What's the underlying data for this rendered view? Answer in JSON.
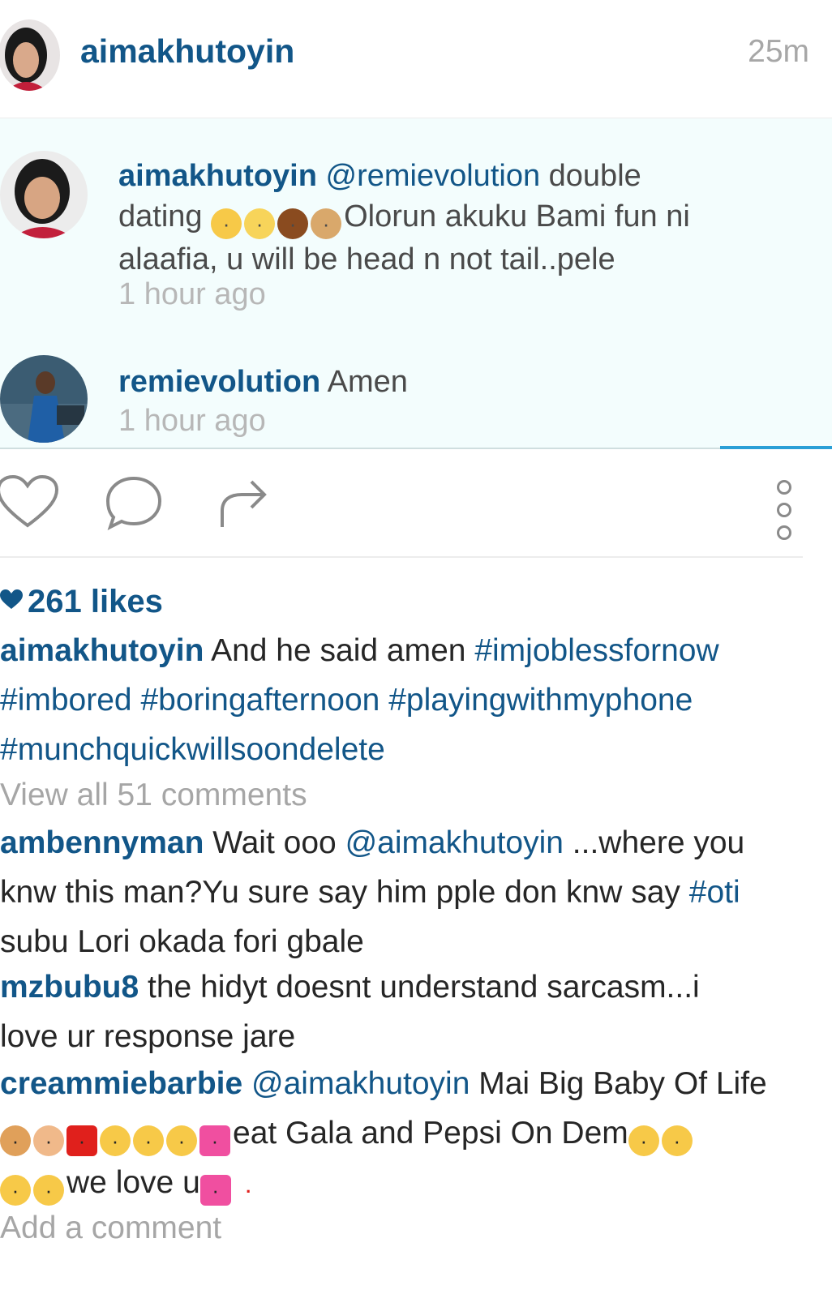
{
  "post": {
    "username": "aimakhutoyin",
    "time": "25m"
  },
  "embedded_comments": [
    {
      "username": "aimakhutoyin",
      "mention": "@remievolution",
      "text_start": "double",
      "text_dating": "dating",
      "text_after_emoji": "Olorun akuku Bami fun ni",
      "text_line3": "alaafia, u will be head n not tail..pele",
      "time": "1 hour ago"
    },
    {
      "username": "remievolution",
      "text": "Amen",
      "time": "1 hour ago"
    }
  ],
  "likes": "261 likes",
  "caption": {
    "username": "aimakhutoyin",
    "text": "And he said amen",
    "tag1": "#imjoblessfornow",
    "tag2": "#imbored",
    "tag3": "#boringafternoon",
    "tag4": "#playingwithmyphone",
    "tag5": "#munchquickwillsoondelete"
  },
  "view_all": "View all 51 comments",
  "comments": [
    {
      "username": "ambennyman",
      "text1": "Wait ooo",
      "mention": "@aimakhutoyin",
      "text2": "...where you",
      "line2": "knw this man?Yu sure say him pple don knw say",
      "tag": "#oti",
      "line3": "subu Lori okada fori gbale"
    },
    {
      "username": "mzbubu8",
      "text1": "the hidyt doesnt understand sarcasm...i",
      "line2": "love ur response jare"
    },
    {
      "username": "creammiebarbie",
      "mention": "@aimakhutoyin",
      "text1": "Mai Big Baby Of Life",
      "line2_text": "eat Gala and Pepsi On Dem",
      "line3_text": "we love u"
    }
  ],
  "add_comment": "Add a comment",
  "colors": {
    "link_blue": "#125688",
    "muted": "#a6a6a6",
    "image_bg": "#f3fdfd",
    "accent": "#2a9fd6"
  },
  "icons": [
    "heart-icon",
    "comment-icon",
    "share-icon",
    "more-icon"
  ]
}
